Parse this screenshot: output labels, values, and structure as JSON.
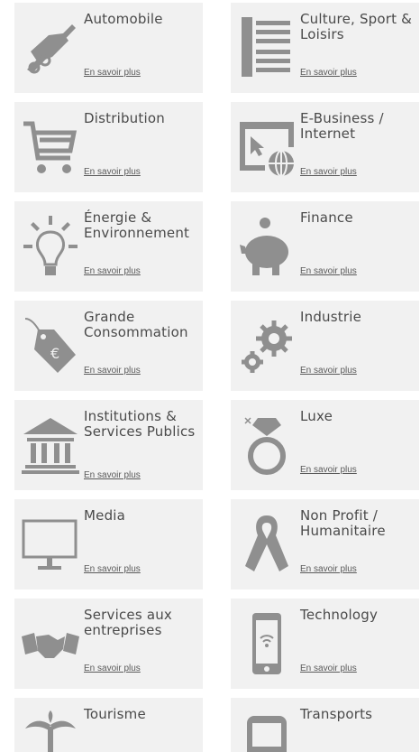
{
  "link_label": "En savoir plus",
  "icon_color": "#8f8f8f",
  "card_background": "#f1f1f1",
  "sectors": [
    {
      "title": "Automobile",
      "icon": "car-crash-icon"
    },
    {
      "title": "Culture, Sport & Loisirs",
      "icon": "document-icon"
    },
    {
      "title": "Distribution",
      "icon": "shopping-cart-icon"
    },
    {
      "title": "E-Business / Internet",
      "icon": "browser-globe-icon"
    },
    {
      "title": "Énergie & Environnement",
      "icon": "lightbulb-icon"
    },
    {
      "title": "Finance",
      "icon": "piggy-bank-icon"
    },
    {
      "title": "Grande Consommation",
      "icon": "price-tag-icon"
    },
    {
      "title": "Industrie",
      "icon": "gears-icon"
    },
    {
      "title": "Institutions & Services Publics",
      "icon": "institution-building-icon"
    },
    {
      "title": "Luxe",
      "icon": "diamond-ring-icon"
    },
    {
      "title": "Media",
      "icon": "monitor-icon"
    },
    {
      "title": "Non Profit / Humanitaire",
      "icon": "ribbon-icon"
    },
    {
      "title": "Services aux entreprises",
      "icon": "handshake-icon"
    },
    {
      "title": "Technology",
      "icon": "smartphone-icon"
    },
    {
      "title": "Tourisme",
      "icon": "palm-tree-icon"
    },
    {
      "title": "Transports",
      "icon": "bus-icon"
    }
  ]
}
